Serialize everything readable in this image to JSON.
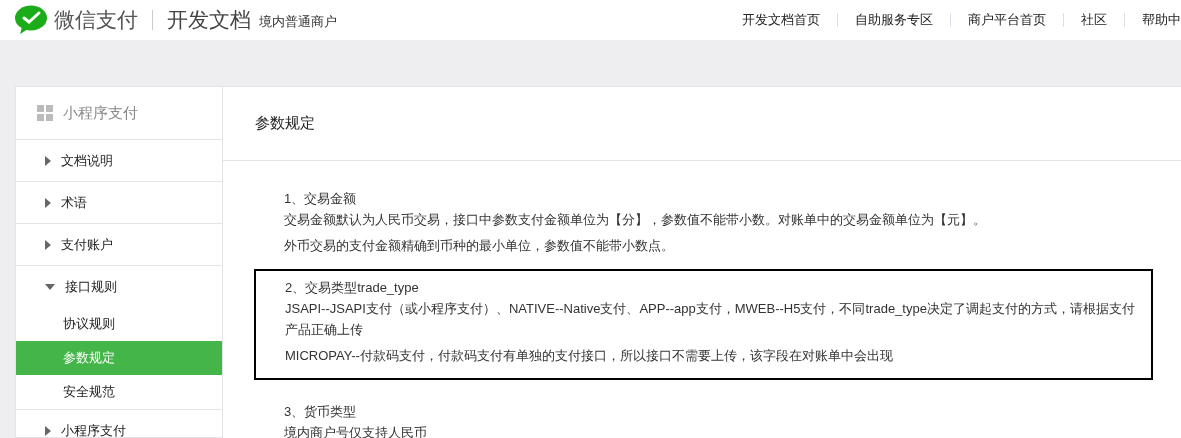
{
  "header": {
    "brand": "微信支付",
    "title": "开发文档",
    "subtitle": "境内普通商户",
    "nav": [
      "开发文档首页",
      "自助服务专区",
      "商户平台首页",
      "社区",
      "帮助中"
    ]
  },
  "sidebar": {
    "title": "小程序支付",
    "items": [
      {
        "label": "文档说明",
        "expanded": false
      },
      {
        "label": "术语",
        "expanded": false
      },
      {
        "label": "支付账户",
        "expanded": false
      },
      {
        "label": "接口规则",
        "expanded": true,
        "children": [
          {
            "label": "协议规则",
            "selected": false
          },
          {
            "label": "参数规定",
            "selected": true
          },
          {
            "label": "安全规范",
            "selected": false
          }
        ]
      },
      {
        "label": "小程序支付",
        "expanded": false
      }
    ]
  },
  "content": {
    "title": "参数规定",
    "sections": [
      {
        "heading": "1、交易金额",
        "highlighted": false,
        "paragraphs": [
          "交易金额默认为人民币交易，接口中参数支付金额单位为【分】，参数值不能带小数。对账单中的交易金额单位为【元】。",
          "外币交易的支付金额精确到币种的最小单位，参数值不能带小数点。"
        ]
      },
      {
        "heading": "2、交易类型trade_type",
        "highlighted": true,
        "paragraphs": [
          "JSAPI--JSAPI支付（或小程序支付）、NATIVE--Native支付、APP--app支付，MWEB--H5支付，不同trade_type决定了调起支付的方式，请根据支付产品正确上传",
          "MICROPAY--付款码支付，付款码支付有单独的支付接口，所以接口不需要上传，该字段在对账单中会出现"
        ]
      },
      {
        "heading": "3、货币类型",
        "highlighted": false,
        "paragraphs": [
          "境内商户号仅支持人民币"
        ]
      }
    ]
  }
}
